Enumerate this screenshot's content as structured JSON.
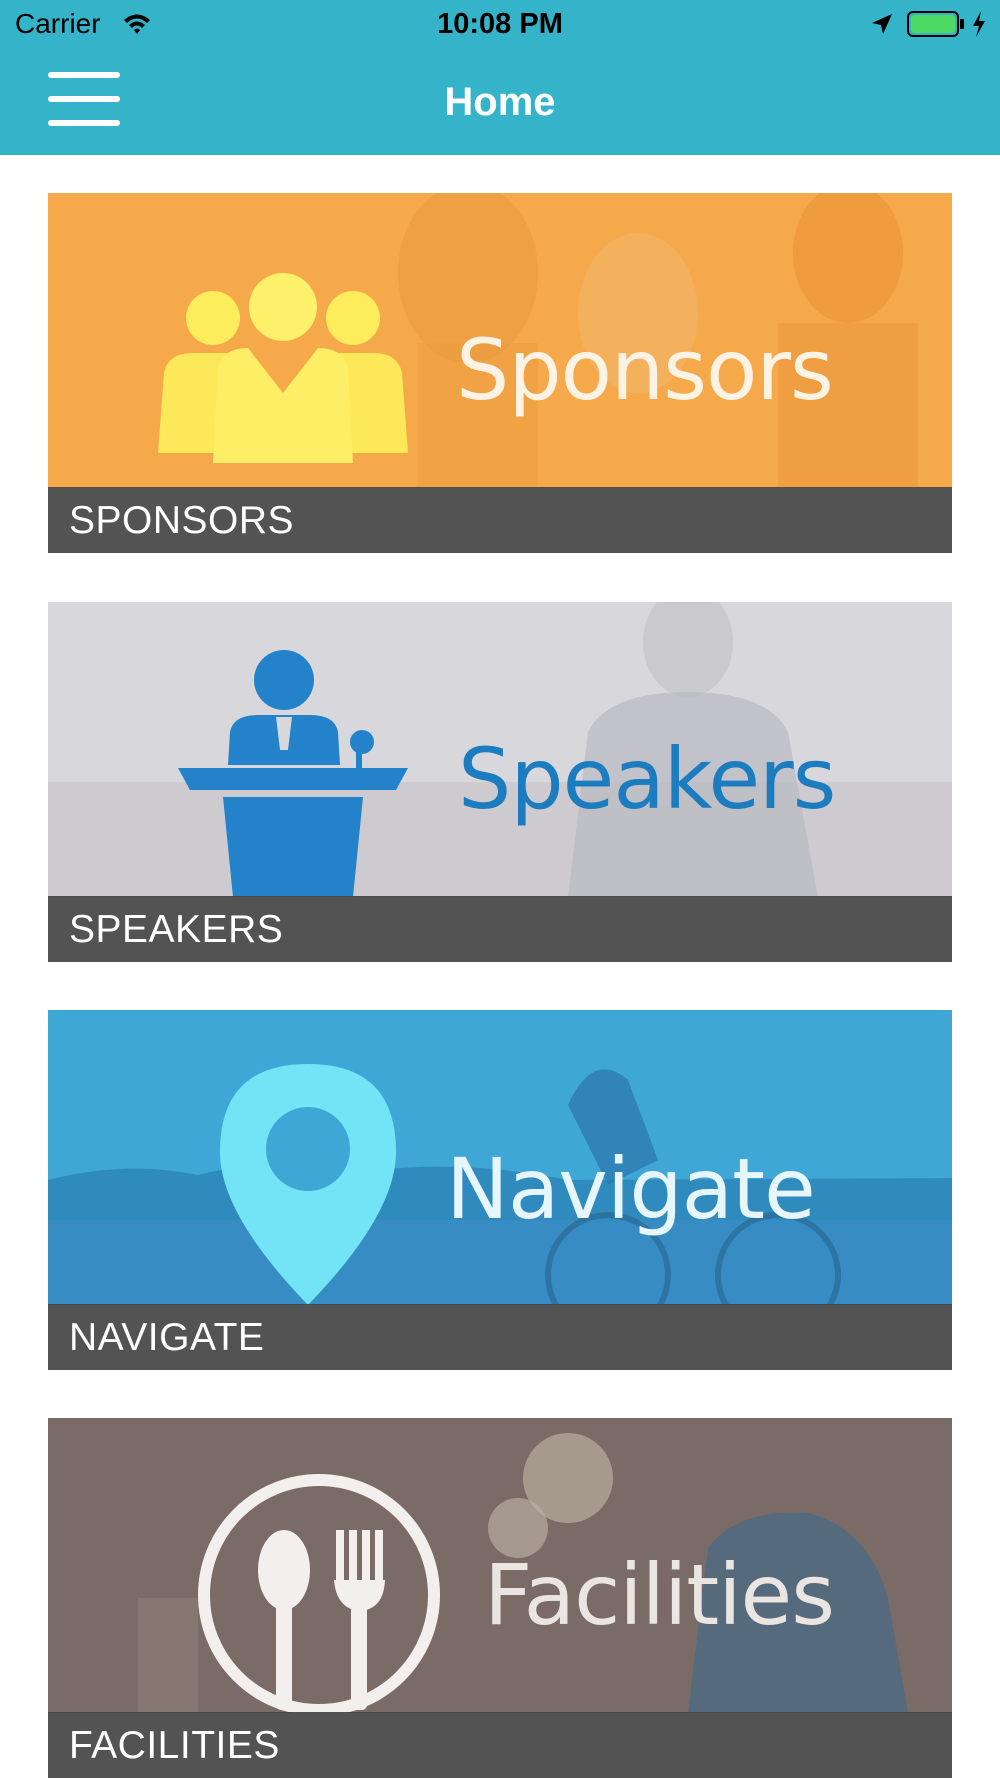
{
  "status_bar": {
    "carrier": "Carrier",
    "time": "10:08 PM",
    "icons": [
      "wifi-icon",
      "location-arrow-icon",
      "battery-icon",
      "charging-bolt-icon"
    ],
    "battery_color": "#4cd964"
  },
  "nav": {
    "title": "Home",
    "menu_icon": "hamburger-menu-icon",
    "color": "#35b3c9"
  },
  "tiles": [
    {
      "caption": "SPONSORS",
      "banner_text": "Sponsors",
      "icon": "group-people-icon",
      "tint": "#f6a94a"
    },
    {
      "caption": "SPEAKERS",
      "banner_text": "Speakers",
      "icon": "speaker-podium-icon",
      "tint": "#d5d4d9"
    },
    {
      "caption": "NAVIGATE",
      "banner_text": "Navigate",
      "icon": "map-pin-icon",
      "tint": "#3ea7d6"
    },
    {
      "caption": "FACILITIES",
      "banner_text": "Facilities",
      "icon": "fork-spoon-icon",
      "tint": "#7a6b66"
    }
  ]
}
